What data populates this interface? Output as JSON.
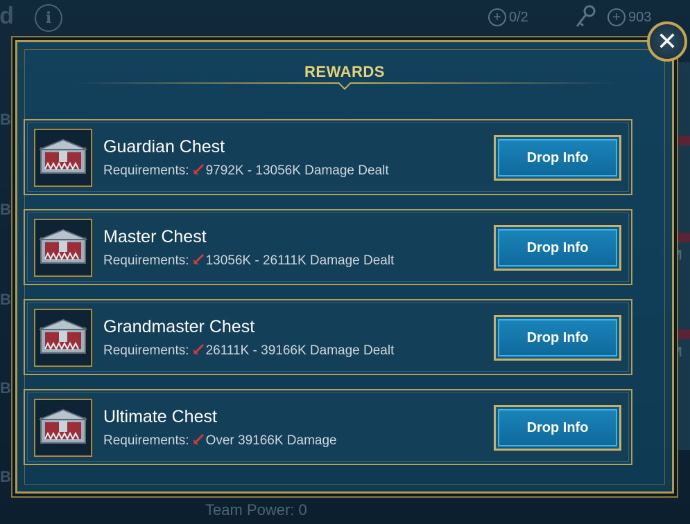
{
  "background": {
    "title_fragment": "rd",
    "side_labels": [
      "Ba",
      "Ba",
      "Ba",
      "Ba",
      "Ba"
    ],
    "right_labels": [
      "M",
      "M"
    ],
    "keys_count": "0/2",
    "currency_count": "903",
    "team_power": "Team Power: 0"
  },
  "modal": {
    "title": "REWARDS",
    "close_label": "✕"
  },
  "rows": [
    {
      "name": "Guardian Chest",
      "req_label": "Requirements:",
      "req_value": "9792K - 13056K Damage Dealt",
      "button": "Drop Info"
    },
    {
      "name": "Master Chest",
      "req_label": "Requirements:",
      "req_value": "13056K - 26111K Damage Dealt",
      "button": "Drop Info"
    },
    {
      "name": "Grandmaster Chest",
      "req_label": "Requirements:",
      "req_value": "26111K - 39166K Damage Dealt",
      "button": "Drop Info"
    },
    {
      "name": "Ultimate Chest",
      "req_label": "Requirements:",
      "req_value": "Over 39166K Damage",
      "button": "Drop Info"
    }
  ],
  "colors": {
    "gold": "#b8a052",
    "title": "#e4d27a",
    "button_blue": "#1a83b8",
    "sword_red": "#d23a3a"
  }
}
